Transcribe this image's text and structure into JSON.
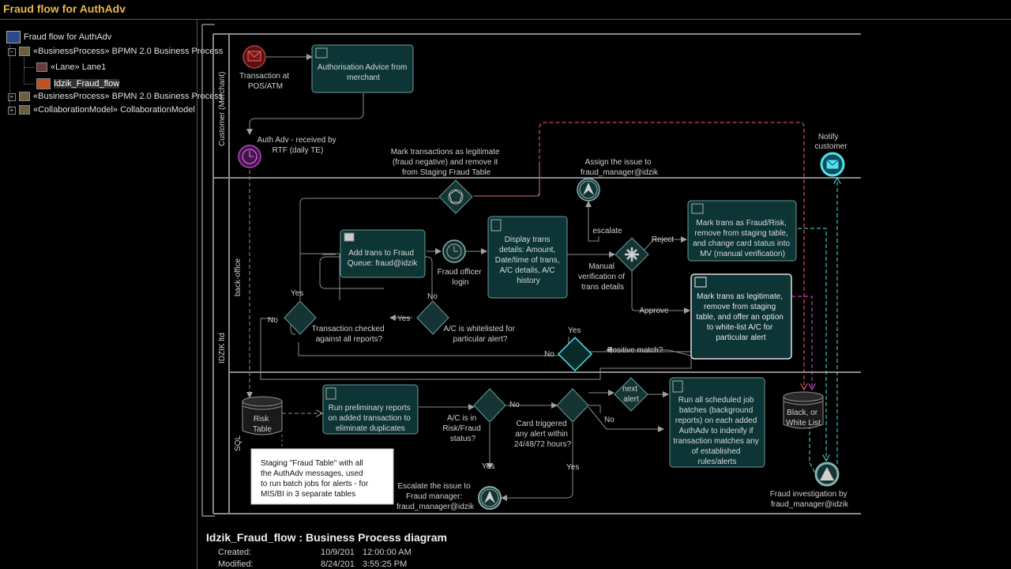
{
  "window": {
    "title": "Fraud flow for AuthAdv"
  },
  "tree": {
    "items": [
      {
        "label": "Fraud flow for AuthAdv"
      },
      {
        "label": "«BusinessProcess» BPMN 2.0 Business Process"
      },
      {
        "label": "«Lane» Lane1"
      },
      {
        "label": "Idzik_Fraud_flow"
      },
      {
        "label": "«BusinessProcess» BPMN 2.0 Business Process"
      },
      {
        "label": "«CollaborationModel» CollaborationModel"
      }
    ]
  },
  "pool": {
    "name": "IDZIK ltd"
  },
  "lanes": [
    {
      "name": "Customer (Merchant)"
    },
    {
      "name": "back-office"
    },
    {
      "name": "SQL"
    }
  ],
  "nodes": {
    "start_event": {
      "label": [
        "Transaction at",
        "POS/ATM"
      ]
    },
    "auth_advice": {
      "label": [
        "Authorisation Advice from",
        "merchant"
      ]
    },
    "auth_received": {
      "label": [
        "Auth Adv - received by",
        "RTF (daily TE)"
      ]
    },
    "mark_legit_gw": {
      "label": [
        "Mark transactions as legitimate",
        "(fraud negative) and remove it",
        "from Staging Fraud Table"
      ]
    },
    "assign_issue": {
      "label": [
        "Assign the issue to",
        "fraud_manager@idzik"
      ]
    },
    "notify_customer": {
      "label": [
        "Notify",
        "customer"
      ]
    },
    "add_queue": {
      "label": [
        "Add trans to Fraud",
        "Queue: fraud@idzik"
      ]
    },
    "officer_login": {
      "label": [
        "Fraud officer",
        "login"
      ]
    },
    "display_details": {
      "label": [
        "Display trans",
        "details: Amount,",
        "Date/time of trans,",
        "A/C details, A/C",
        "history"
      ]
    },
    "manual_verif": {
      "label": [
        "Manual",
        "verification of",
        "trans details"
      ]
    },
    "escalate_lbl": "escalate",
    "reject_lbl": "Reject",
    "approve_lbl": "Approve",
    "mark_fraud": {
      "label": [
        "Mark trans as Fraud/Risk,",
        "remove from staging table,",
        "and change card status into",
        "MV (manual verification)"
      ]
    },
    "mark_legit": {
      "label": [
        "Mark trans as legitimate,",
        "remove from staging",
        "table, and offer an option",
        "to white-list A/C for",
        "particular alert"
      ]
    },
    "checked_gw": {
      "label": [
        "Transaction checked",
        "against all reports?"
      ]
    },
    "whitelist_gw": {
      "label": [
        "A/C is whitelisted for",
        "particular alert?"
      ]
    },
    "positive_match": "Positive match?",
    "risk_table": {
      "label": [
        "Risk",
        "Table"
      ]
    },
    "prelim_reports": {
      "label": [
        "Run preliminary reports",
        "on added transaction to",
        "eliminate duplicates"
      ]
    },
    "risk_status_gw": {
      "label": [
        "A/C is in",
        "Risk/Fraud",
        "status?"
      ]
    },
    "card_triggered_gw": {
      "label": [
        "Card triggered",
        "any alert within",
        "24/48/72 hours?"
      ]
    },
    "next_alert": {
      "label": [
        "next",
        "alert"
      ]
    },
    "run_batches": {
      "label": [
        "Run all scheduled job",
        "batches (background",
        "reports) on each added",
        "AuthAdv to indenify if",
        "transaction matches any",
        "of established",
        "rules/alerts"
      ]
    },
    "black_white": {
      "label": [
        "Black, or",
        "White List"
      ]
    },
    "escalate_issue": {
      "label": [
        "Escalate the issue to",
        "Fraud manager:",
        "fraud_manager@idzik"
      ]
    },
    "fraud_invest": {
      "label": [
        "Fraud investigation by",
        "fraud_manager@idzik"
      ]
    },
    "note": {
      "label": [
        "Staging \"Fraud Table\" with all",
        "the AuthAdv messages, used",
        "to run batch jobs for alerts - for",
        "MIS/BI in 3 separate tables"
      ]
    },
    "yes": "Yes",
    "no": "No"
  },
  "footer": {
    "title": "Idzik_Fraud_flow : Business Process diagram",
    "created_label": "Created:",
    "created_date": "10/9/201",
    "created_time": "12:00:00 AM",
    "modified_label": "Modified:",
    "modified_date": "8/24/201",
    "modified_time": "3:55:25 PM"
  },
  "colors": {
    "accent_title": "#e6b84a",
    "task_fill": "#0d3535",
    "task_stroke": "#5f8f8f",
    "connector": "#9a9a9a",
    "message_flow": "#ff5f7a",
    "cyan_flow": "#4fe3f0",
    "magenta_flow": "#e050e0"
  }
}
